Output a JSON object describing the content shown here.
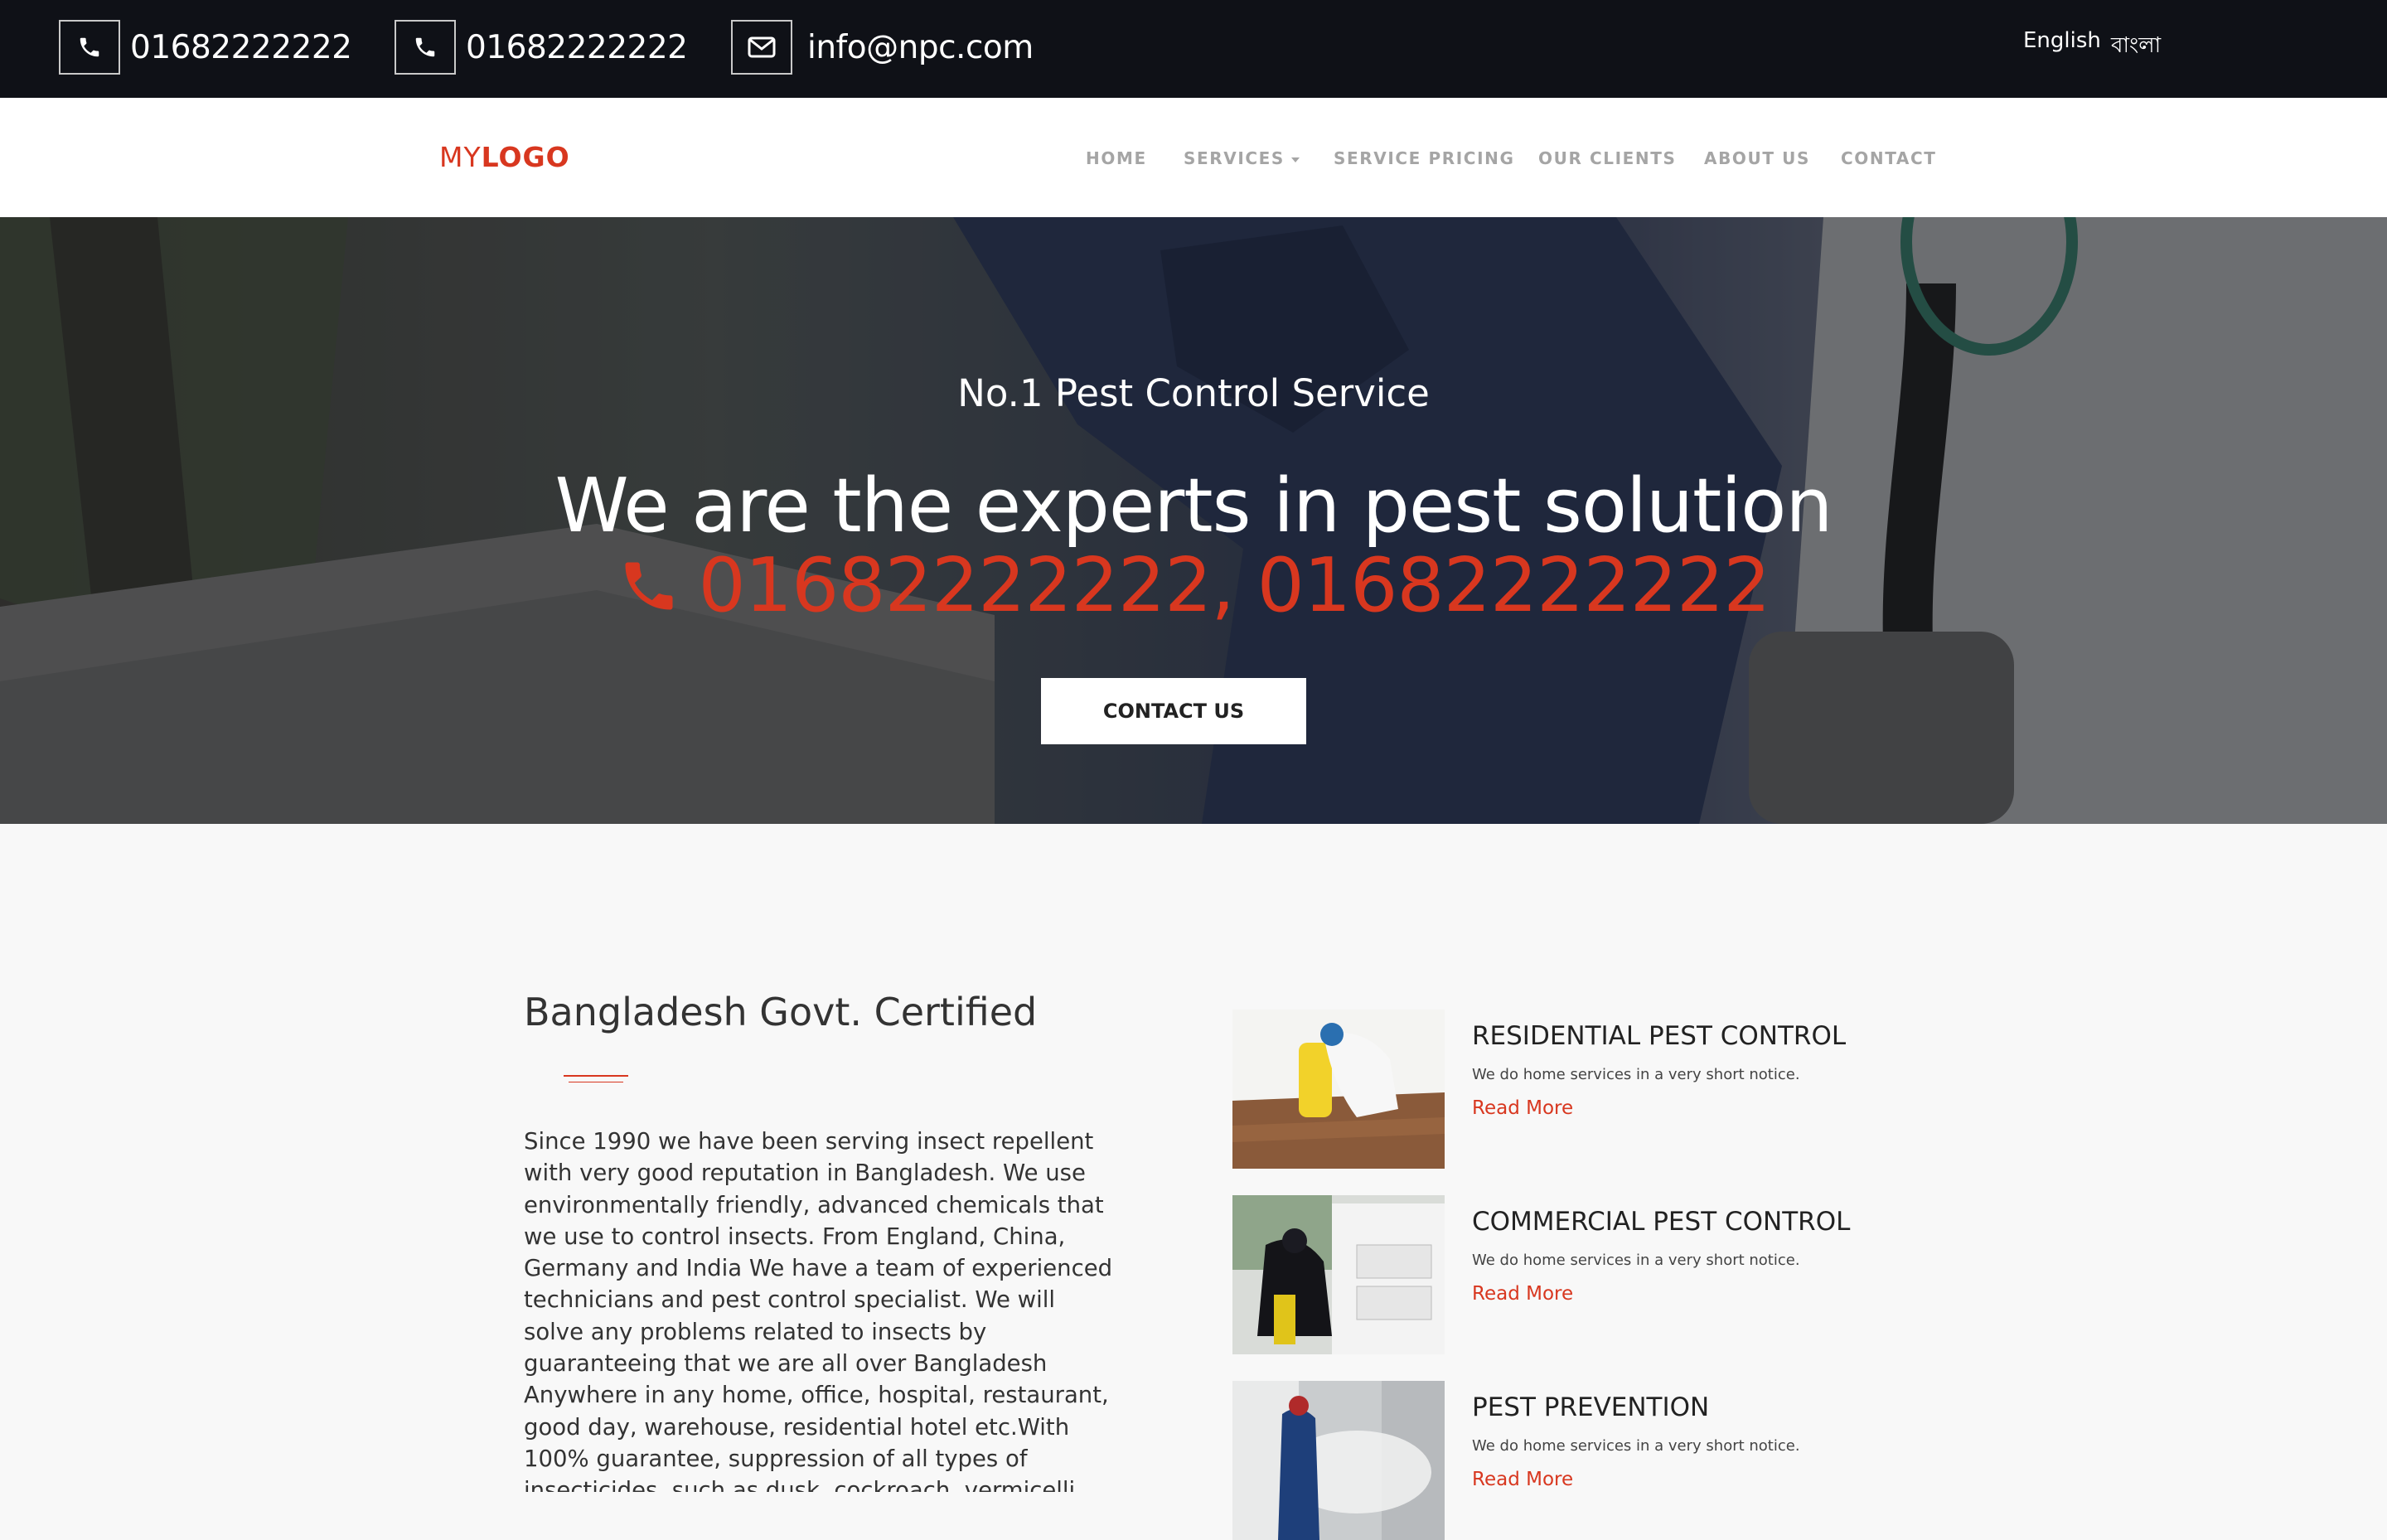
{
  "topbar": {
    "phone1": "01682222222",
    "phone2": "01682222222",
    "email": "info@npc.com",
    "lang_en": "English",
    "lang_bn": "বাংলা"
  },
  "nav": {
    "logo_prefix": "MY",
    "logo_bold": "LOGO",
    "items": [
      "HOME",
      "SERVICES",
      "SERVICE PRICING",
      "OUR CLIENTS",
      "ABOUT US",
      "CONTACT"
    ]
  },
  "hero": {
    "subtitle": "No.1 Pest Control Service",
    "title": "We are the experts in pest solution",
    "phones": "01682222222, 01682222222",
    "button": "CONTACT US"
  },
  "about": {
    "title": "Bangladesh Govt. Certified",
    "text": "Since 1990 we have been serving insect repellent with very good reputation in Bangladesh. We use environmentally friendly, advanced chemicals that we use to control insects. From England, China, Germany and India We have a team of experienced technicians and pest control specialist. We will solve any problems related to insects by guaranteeing that we are all over Bangladesh Anywhere in any home, office, hospital, restaurant, good day, warehouse, residential hotel etc.With 100% guarantee, suppression of all types of insecticides, such as dusk, cockroach, vermicelli, tamarind and fly"
  },
  "services": [
    {
      "title": "RESIDENTIAL PEST CONTROL",
      "desc": "We do home services in a very short notice.",
      "link": "Read More"
    },
    {
      "title": "COMMERCIAL PEST CONTROL",
      "desc": "We do home services in a very short notice.",
      "link": "Read More"
    },
    {
      "title": "PEST PREVENTION",
      "desc": "We do home services in a very short notice.",
      "link": "Read More"
    }
  ],
  "colors": {
    "accent": "#d8371f",
    "topbar_bg": "#0f1117",
    "nav_link": "#a5a5a5",
    "page_bg": "#f8f8f8"
  },
  "icons": [
    "phone-icon",
    "envelope-icon",
    "caret-down-icon"
  ]
}
